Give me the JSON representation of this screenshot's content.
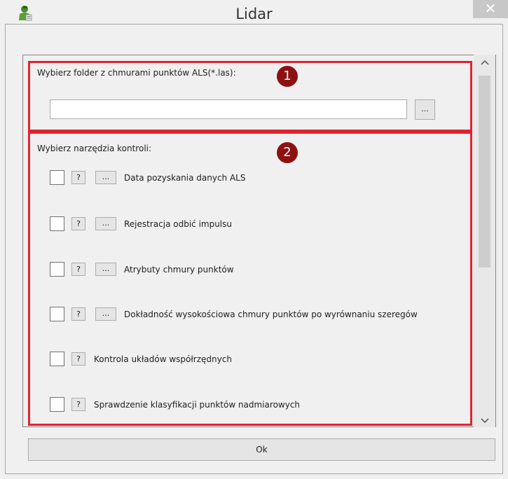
{
  "window": {
    "title": "Lidar",
    "close_label": "✕",
    "icon": "app-person-icon"
  },
  "folder_section": {
    "label": "Wybierz folder z chmurami punktów ALS(*.las):",
    "badge": "1",
    "path_value": "",
    "browse_label": "..."
  },
  "tools_section": {
    "label": "Wybierz narzędzia kontroli:",
    "badge": "2",
    "items": [
      {
        "checked": false,
        "help_label": "?",
        "options_label": "...",
        "label": "Data pozyskania danych ALS"
      },
      {
        "checked": false,
        "help_label": "?",
        "options_label": "...",
        "label": "Rejestracja odbić impulsu"
      },
      {
        "checked": false,
        "help_label": "?",
        "options_label": "...",
        "label": "Atrybuty chmury punktów"
      },
      {
        "checked": false,
        "help_label": "?",
        "options_label": "...",
        "label": "Dokładność wysokościowa chmury punktów po wyrównaniu szeregów"
      },
      {
        "checked": false,
        "help_label": "?",
        "label": "Kontrola układów współrzędnych"
      },
      {
        "checked": false,
        "help_label": "?",
        "label": "Sprawdzenie klasyfikacji punktów nadmiarowych"
      }
    ]
  },
  "scrollbar": {
    "up_icon": "chevron-up-icon",
    "down_icon": "chevron-down-icon"
  },
  "footer": {
    "ok_label": "Ok"
  },
  "colors": {
    "highlight_border": "#e0242f",
    "badge_bg": "#8e1111",
    "close_bg": "#c7c7c7"
  }
}
